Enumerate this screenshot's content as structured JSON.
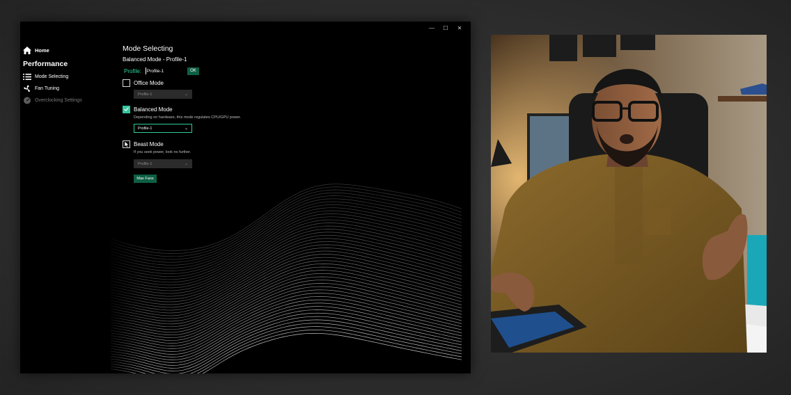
{
  "window": {
    "minimize_glyph": "—",
    "maximize_glyph": "☐",
    "close_glyph": "✕"
  },
  "sidebar": {
    "home_label": "Home",
    "section_label": "Performance",
    "items": [
      {
        "label": "Mode Selecting",
        "icon": "list-icon",
        "state": "active"
      },
      {
        "label": "Fan Tuning",
        "icon": "fan-icon",
        "state": "normal"
      },
      {
        "label": "Overclocking Settings",
        "icon": "speedometer-icon",
        "state": "disabled"
      }
    ]
  },
  "main": {
    "title": "Mode Selecting",
    "subtitle": "Balanced Mode - Profile-1",
    "profile_label": "Profile:",
    "profile_value": "Profile-1",
    "ok_label": "OK",
    "modes": [
      {
        "name": "Office Mode",
        "description": "",
        "select_value": "Profile-1",
        "checked": false
      },
      {
        "name": "Balanced Mode",
        "description": "Depending on hardware, this mode regulates CPU/GPU power.",
        "select_value": "Profile-1",
        "checked": true
      },
      {
        "name": "Beast Mode",
        "description": "If you seek power, look no further.",
        "select_value": "Profile-1",
        "checked": false
      }
    ],
    "max_fans_label": "Max Fans"
  },
  "colors": {
    "accent": "#2fd59b",
    "button_bg": "#0e5f43",
    "checkbox_checked": "#33c7a0",
    "window_bg": "#000000"
  }
}
